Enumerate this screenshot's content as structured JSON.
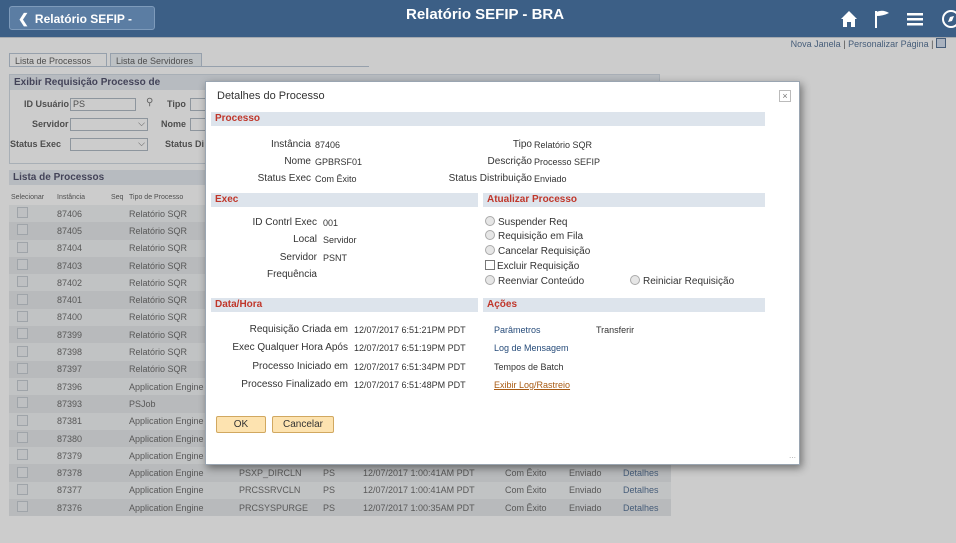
{
  "header": {
    "back_label": "Relatório SEFIP - BRA",
    "title": "Relatório SEFIP - BRA",
    "icons": [
      "home-icon",
      "flag-icon",
      "menu-icon",
      "compass-icon"
    ]
  },
  "top_links": {
    "nova_janela": "Nova Janela",
    "sep1": "|",
    "personalizar": "Personalizar Página",
    "sep2": "|"
  },
  "tabs": [
    "Lista de Processos",
    "Lista de Servidores"
  ],
  "exibir": {
    "title": "Exibir Requisição Processo de",
    "id_usuario_label": "ID Usuário",
    "id_usuario_value": "PS",
    "tipo_label": "Tipo",
    "servidor_label": "Servidor",
    "nome_label": "Nome",
    "status_exec_label": "Status Exec",
    "status_di_label": "Status Di"
  },
  "lista": {
    "title": "Lista de Processos",
    "columns": [
      "Selecionar",
      "Instância",
      "Seq",
      "Tipo de Processo"
    ],
    "rows": [
      {
        "inst": "87406",
        "tipo": "Relatório SQR"
      },
      {
        "inst": "87405",
        "tipo": "Relatório SQR"
      },
      {
        "inst": "87404",
        "tipo": "Relatório SQR"
      },
      {
        "inst": "87403",
        "tipo": "Relatório SQR"
      },
      {
        "inst": "87402",
        "tipo": "Relatório SQR"
      },
      {
        "inst": "87401",
        "tipo": "Relatório SQR"
      },
      {
        "inst": "87400",
        "tipo": "Relatório SQR"
      },
      {
        "inst": "87399",
        "tipo": "Relatório SQR"
      },
      {
        "inst": "87398",
        "tipo": "Relatório SQR"
      },
      {
        "inst": "87397",
        "tipo": "Relatório SQR"
      },
      {
        "inst": "87396",
        "tipo": "Application Engine"
      },
      {
        "inst": "87393",
        "tipo": "PSJob"
      },
      {
        "inst": "87381",
        "tipo": "Application Engine"
      },
      {
        "inst": "87380",
        "tipo": "Application Engine"
      },
      {
        "inst": "87379",
        "tipo": "Application Engine",
        "nome": "PSXPARCHATTR",
        "user": "PS",
        "data": "12/07/2017 1:00:41AM PDT",
        "status": "Com Êxito",
        "dist": "Enviado",
        "det": "Detalhes"
      },
      {
        "inst": "87378",
        "tipo": "Application Engine",
        "nome": "PSXP_DIRCLN",
        "user": "PS",
        "data": "12/07/2017 1:00:41AM PDT",
        "status": "Com Êxito",
        "dist": "Enviado",
        "det": "Detalhes"
      },
      {
        "inst": "87377",
        "tipo": "Application Engine",
        "nome": "PRCSSRVCLN",
        "user": "PS",
        "data": "12/07/2017 1:00:41AM PDT",
        "status": "Com Êxito",
        "dist": "Enviado",
        "det": "Detalhes"
      },
      {
        "inst": "87376",
        "tipo": "Application Engine",
        "nome": "PRCSYSPURGE",
        "user": "PS",
        "data": "12/07/2017 1:00:35AM PDT",
        "status": "Com Êxito",
        "dist": "Enviado",
        "det": "Detalhes"
      }
    ]
  },
  "modal": {
    "title": "Detalhes do Processo",
    "processo": {
      "header": "Processo",
      "instancia_label": "Instância",
      "instancia": "87406",
      "nome_label": "Nome",
      "nome": "GPBRSF01",
      "status_exec_label": "Status Exec",
      "status_exec": "Com Êxito",
      "tipo_label": "Tipo",
      "tipo": "Relatório SQR",
      "descricao_label": "Descrição",
      "descricao": "Processo SEFIP",
      "status_dist_label": "Status Distribuição",
      "status_dist": "Enviado"
    },
    "exec": {
      "header": "Exec",
      "id_contrl_label": "ID Contrl Exec",
      "id_contrl": "001",
      "local_label": "Local",
      "local": "Servidor",
      "servidor_label": "Servidor",
      "servidor": "PSNT",
      "frequencia_label": "Frequência"
    },
    "atualizar": {
      "header": "Atualizar Processo",
      "options": [
        "Suspender Req",
        "Requisição em Fila",
        "Cancelar Requisição",
        "Excluir Requisição",
        "Reenviar Conteúdo",
        "Reiniciar Requisição"
      ]
    },
    "datahora": {
      "header": "Data/Hora",
      "rows": [
        {
          "label": "Requisição Criada em",
          "value": "12/07/2017  6:51:21PM PDT"
        },
        {
          "label": "Exec Qualquer Hora Após",
          "value": "12/07/2017  6:51:19PM PDT"
        },
        {
          "label": "Processo Iniciado em",
          "value": "12/07/2017  6:51:34PM PDT"
        },
        {
          "label": "Processo Finalizado em",
          "value": "12/07/2017  6:51:48PM PDT"
        }
      ]
    },
    "acoes": {
      "header": "Ações",
      "parametros": "Parâmetros",
      "transferir": "Transferir",
      "log_mensagem": "Log de Mensagem",
      "tempos_batch": "Tempos de Batch",
      "exibir_log": "Exibir Log/Rastreio"
    },
    "ok": "OK",
    "cancelar": "Cancelar"
  }
}
